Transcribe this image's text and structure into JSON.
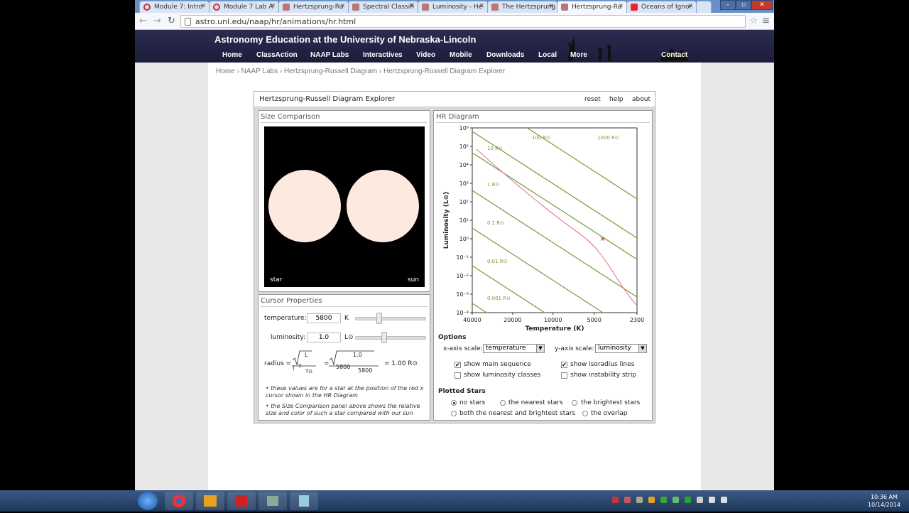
{
  "browser": {
    "tabs": [
      {
        "label": "Module 7: Intro",
        "color": "#c33"
      },
      {
        "label": "Module 7 Lab A",
        "color": "#c33"
      },
      {
        "label": "Hertzsprung-Ru",
        "color": "#b77"
      },
      {
        "label": "Spectral Classifi",
        "color": "#b77"
      },
      {
        "label": "Luminosity - He",
        "color": "#b77"
      },
      {
        "label": "The Hertzsprung",
        "color": "#b77"
      },
      {
        "label": "Hertzsprung-Ru",
        "color": "#b77",
        "active": true
      },
      {
        "label": "Oceans of Ignor",
        "color": "#e22"
      }
    ],
    "url": "astro.unl.edu/naap/hr/animations/hr.html"
  },
  "site": {
    "title": "Astronomy Education at the University of Nebraska-Lincoln",
    "nav": [
      "Home",
      "ClassAction",
      "NAAP Labs",
      "Interactives",
      "Video",
      "Mobile",
      "Downloads",
      "Local",
      "More",
      "Contact"
    ],
    "breadcrumb": "Home › NAAP Labs › Hertzsprung-Russell Diagram › Hertzsprung-Russell Diagram Explorer"
  },
  "app": {
    "title": "Hertzsprung-Russell Diagram Explorer",
    "links": {
      "reset": "reset",
      "help": "help",
      "about": "about"
    },
    "size_comparison": {
      "heading": "Size Comparison",
      "star_label": "star",
      "sun_label": "sun"
    },
    "cursor": {
      "heading": "Cursor Properties",
      "temperature_label": "temperature:",
      "temperature_value": "5800",
      "temperature_unit": "K",
      "temperature_slider": 0.33,
      "luminosity_label": "luminosity:",
      "luminosity_value": "1.0",
      "luminosity_unit": "L⊙",
      "luminosity_slider": 0.4,
      "radius_label": "radius =",
      "radius_formula_L": "L",
      "radius_formula_T": "T",
      "radius_formula_Tsun": "T⊙",
      "radius_numer": "1.0",
      "radius_denom_num": "5800",
      "radius_denom_den": "5800",
      "radius_result": "= 1.00 R⊙",
      "note1": "• these values are for a star at the position of the red x cursor shown in the HR Diagram",
      "note2": "• the Size Comparison panel above shows the relative size and color of such a star compared with our sun"
    },
    "hr": {
      "heading": "HR Diagram",
      "ylabel": "Luminosity (L⊙)",
      "xlabel": "Temperature (K)",
      "y_ticks": [
        "10⁶",
        "10⁵",
        "10⁴",
        "10³",
        "10²",
        "10¹",
        "10⁰",
        "10⁻¹",
        "10⁻²",
        "10⁻³",
        "10⁻⁴"
      ],
      "x_ticks": [
        "40000",
        "20000",
        "10000",
        "5000",
        "2300"
      ],
      "isoradius_labels": [
        "100 R⊙",
        "1000 R⊙",
        "10 R⊙",
        "1 R⊙",
        "0.1 R⊙",
        "0.01 R⊙",
        "0.001 R⊙"
      ]
    },
    "options": {
      "heading": "Options",
      "xaxis_label": "x-axis scale:",
      "xaxis_value": "temperature",
      "yaxis_label": "y-axis scale:",
      "yaxis_value": "luminosity",
      "show_main_sequence": "show main sequence",
      "show_isoradius": "show isoradius lines",
      "show_lum_classes": "show luminosity classes",
      "show_instability": "show instability strip"
    },
    "plotted": {
      "heading": "Plotted Stars",
      "no_stars": "no stars",
      "nearest": "the nearest stars",
      "brightest": "the brightest stars",
      "both": "both the nearest and brightest stars",
      "overlap": "the overlap"
    }
  },
  "taskbar": {
    "time": "10:36 AM",
    "date": "10/14/2014"
  }
}
